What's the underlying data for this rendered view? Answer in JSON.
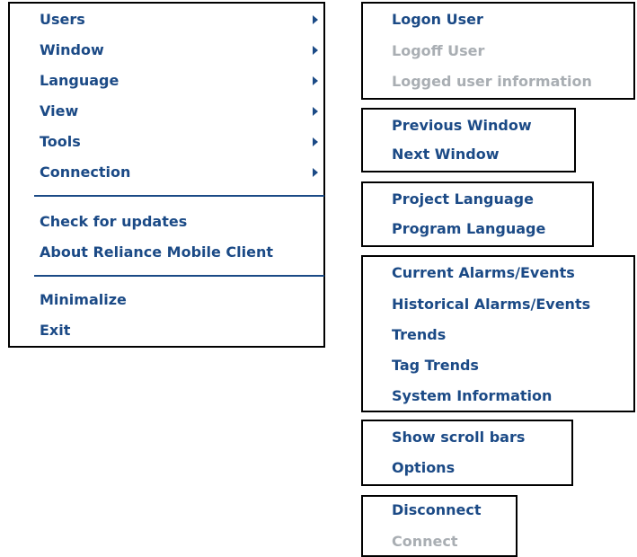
{
  "main_menu": {
    "items": [
      {
        "label": "Users",
        "has_submenu": true
      },
      {
        "label": "Window",
        "has_submenu": true
      },
      {
        "label": "Language",
        "has_submenu": true
      },
      {
        "label": "View",
        "has_submenu": true
      },
      {
        "label": "Tools",
        "has_submenu": true
      },
      {
        "label": "Connection",
        "has_submenu": true
      }
    ],
    "group2": [
      {
        "label": "Check for updates"
      },
      {
        "label": "About Reliance Mobile Client"
      }
    ],
    "group3": [
      {
        "label": "Minimalize"
      },
      {
        "label": "Exit"
      }
    ]
  },
  "users_menu": {
    "items": [
      {
        "label": "Logon User",
        "enabled": true
      },
      {
        "label": "Logoff User",
        "enabled": false
      },
      {
        "label": "Logged user information",
        "enabled": false
      }
    ]
  },
  "window_menu": {
    "items": [
      {
        "label": "Previous Window",
        "enabled": true
      },
      {
        "label": "Next Window",
        "enabled": true
      }
    ]
  },
  "language_menu": {
    "items": [
      {
        "label": "Project Language",
        "enabled": true
      },
      {
        "label": "Program Language",
        "enabled": true
      }
    ]
  },
  "view_menu": {
    "items": [
      {
        "label": "Current Alarms/Events",
        "enabled": true
      },
      {
        "label": "Historical Alarms/Events",
        "enabled": true
      },
      {
        "label": "Trends",
        "enabled": true
      },
      {
        "label": "Tag Trends",
        "enabled": true
      },
      {
        "label": "System Information",
        "enabled": true
      }
    ]
  },
  "tools_menu": {
    "items": [
      {
        "label": "Show scroll bars",
        "enabled": true
      },
      {
        "label": "Options",
        "enabled": true
      }
    ]
  },
  "connection_menu": {
    "items": [
      {
        "label": "Disconnect",
        "enabled": true
      },
      {
        "label": "Connect",
        "enabled": false
      }
    ]
  },
  "colors": {
    "text": "#1b4a86",
    "disabled_text": "#a9aeb3",
    "border": "#000000",
    "background": "#ffffff"
  },
  "icons": {
    "submenu_arrow": "triangle-right"
  }
}
